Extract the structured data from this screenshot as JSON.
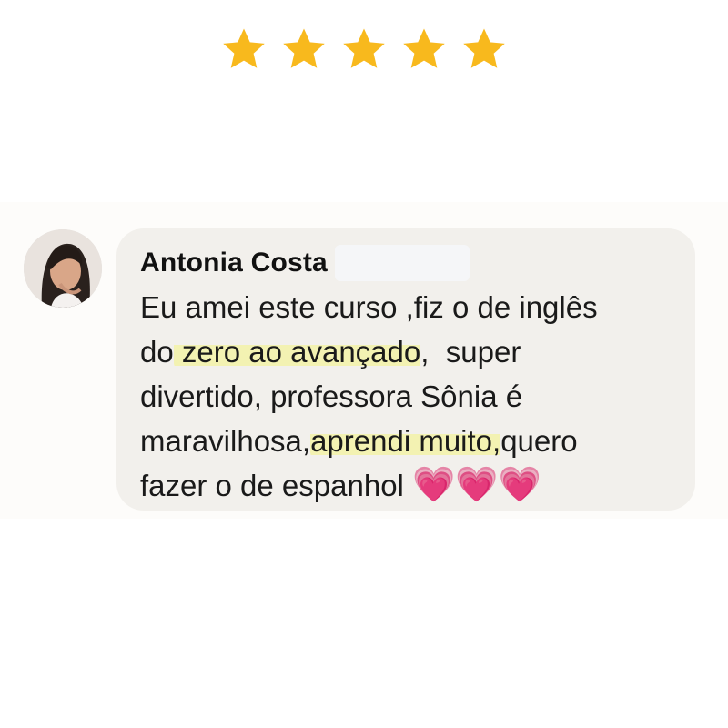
{
  "rating": {
    "value": 5,
    "max": 5,
    "star_color": "#f8b91d",
    "icon": "star-icon"
  },
  "review": {
    "author": "Antonia Costa",
    "avatar": "user-avatar",
    "highlight_color": "#f3f2b2",
    "text": {
      "line1": "Eu amei este curso ,fiz o de inglês",
      "l2_pre": "do",
      "l2_hl": " zero ao avançado",
      "l2_post": ",  super",
      "line3": "divertido, professora Sônia é",
      "l4_pre": "maravilhosa,",
      "l4_hl": "aprendi muito,",
      "l4_post": "quero",
      "l5": "fazer o de espanhol "
    },
    "emojis": [
      "💗",
      "💗",
      "💗"
    ],
    "emoji_color": "#e64fae"
  }
}
